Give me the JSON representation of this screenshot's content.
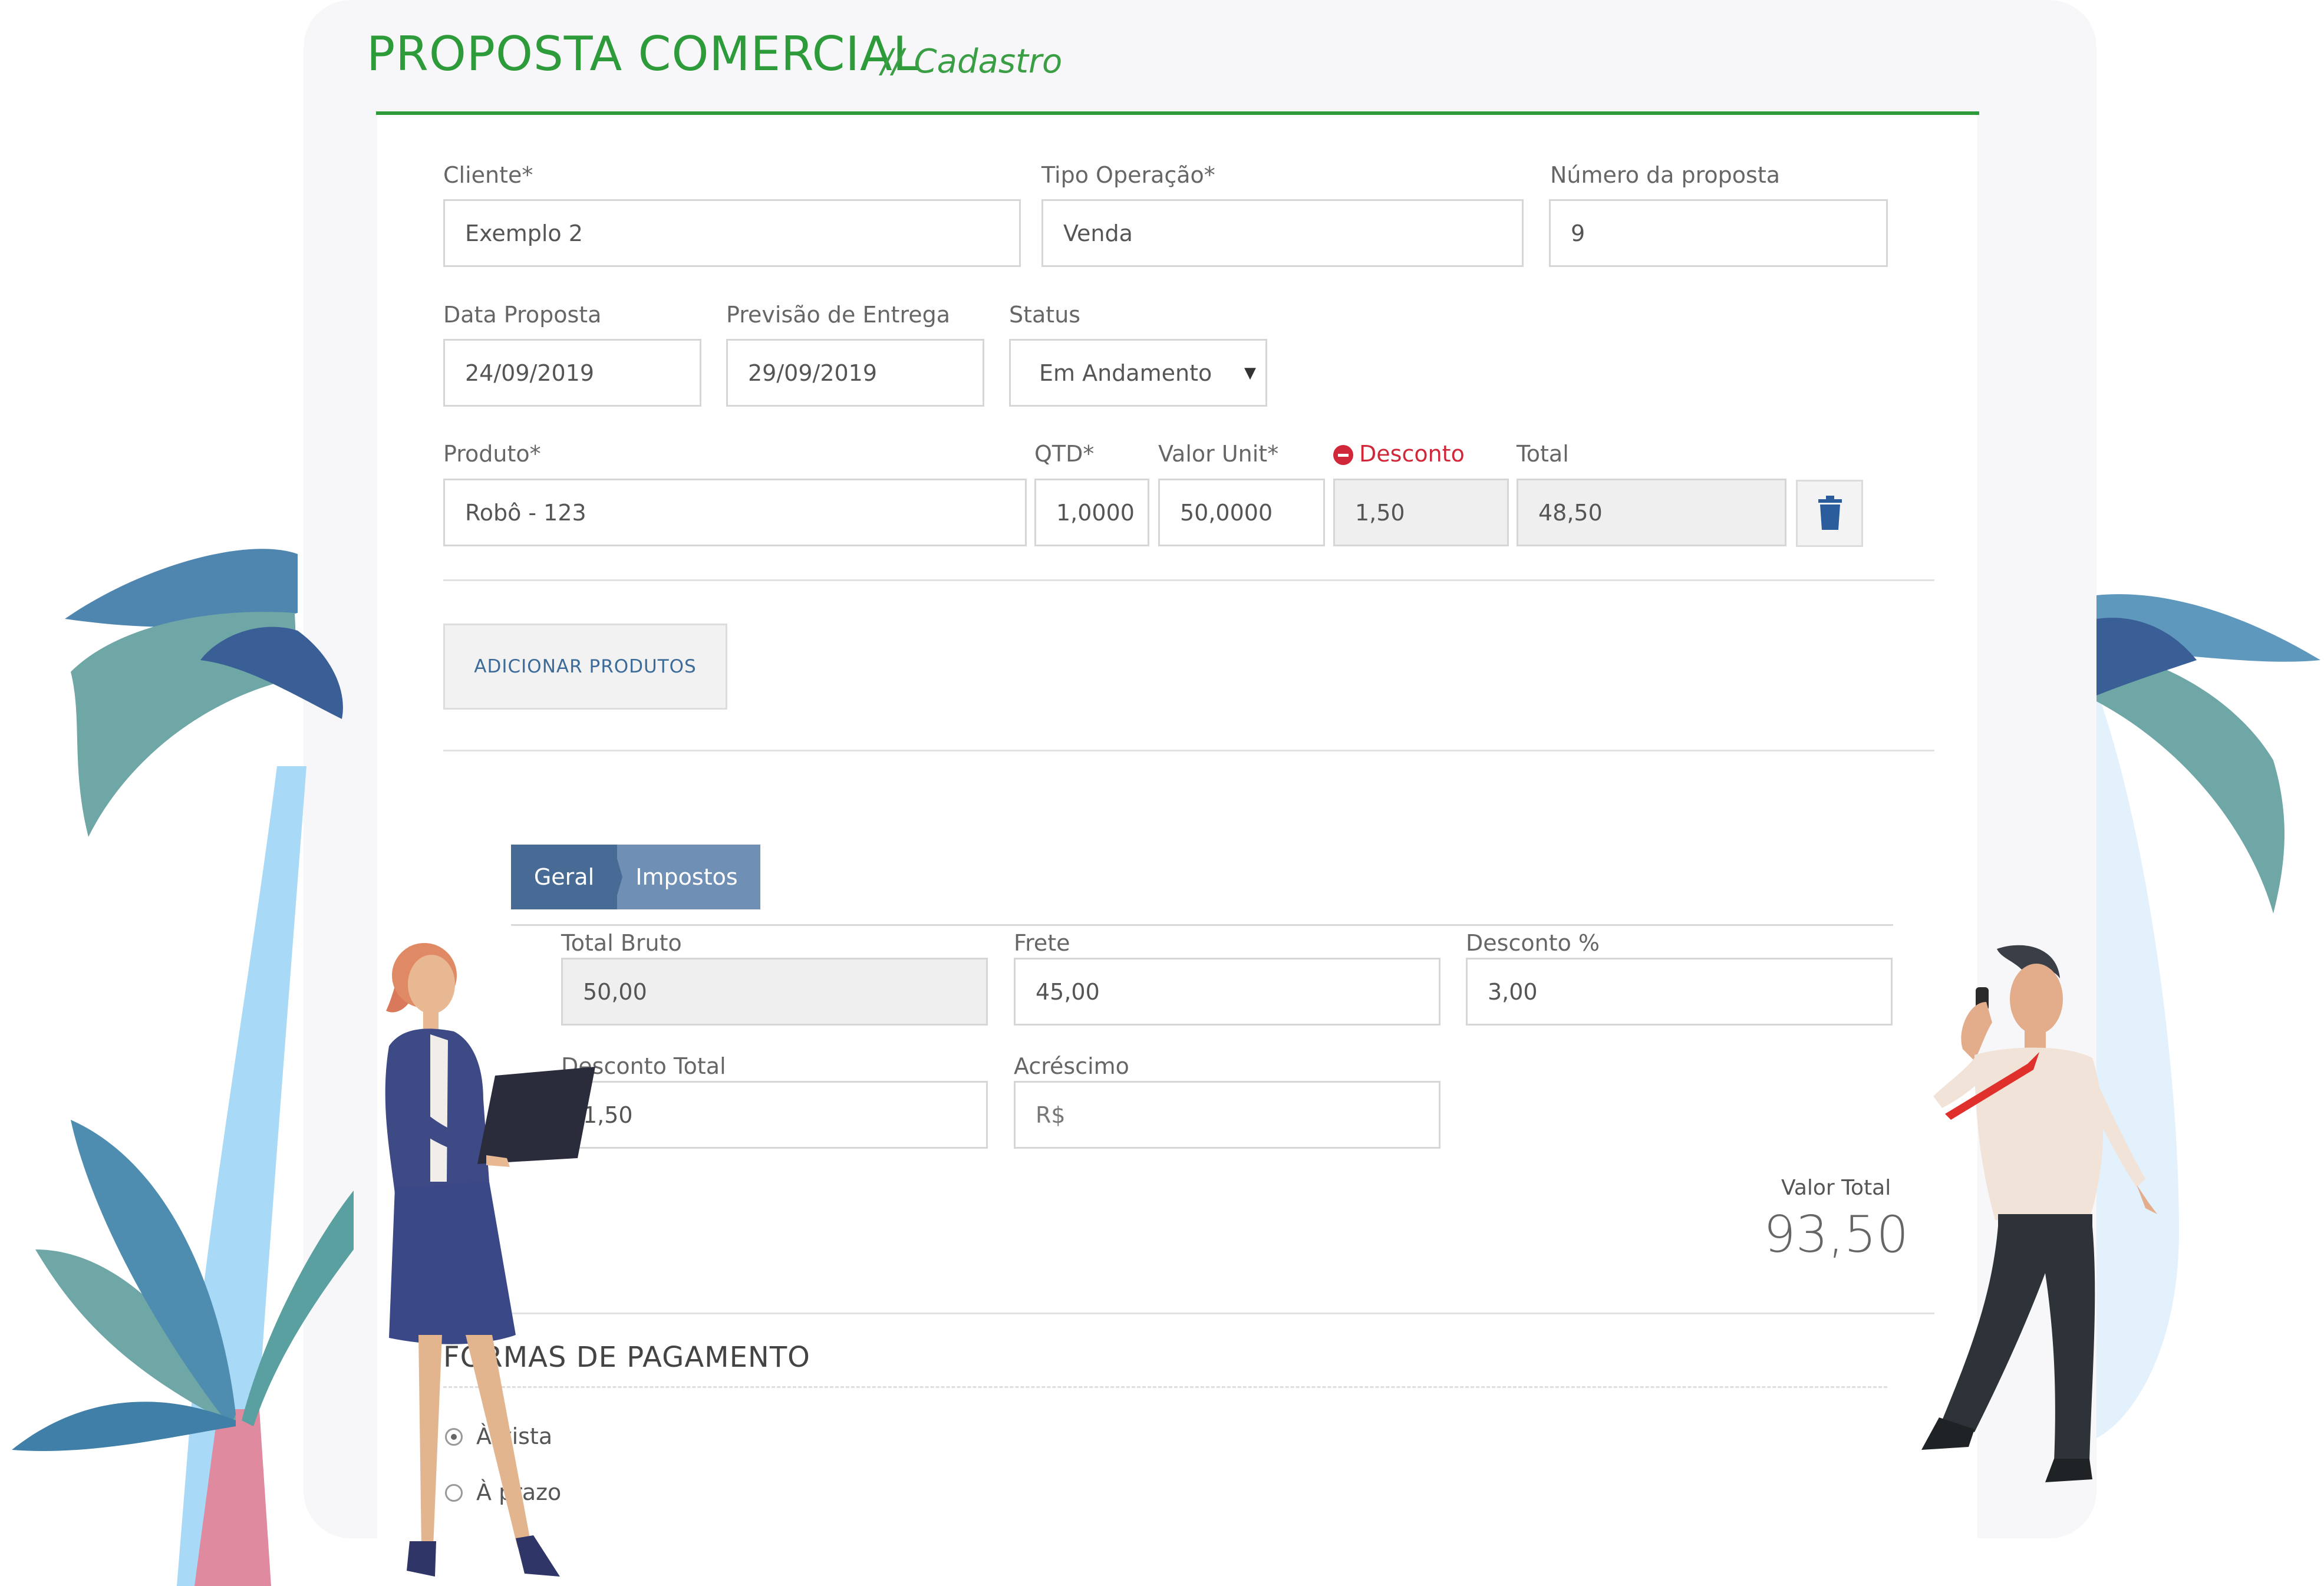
{
  "header": {
    "title": "PROPOSTA COMERCIAL",
    "subtitle": "// Cadastro"
  },
  "form": {
    "cliente": {
      "label": "Cliente*",
      "value": "Exemplo 2"
    },
    "tipo_operacao": {
      "label": "Tipo Operação*",
      "value": "Venda"
    },
    "numero_proposta": {
      "label": "Número da proposta",
      "value": "9"
    },
    "data_proposta": {
      "label": "Data Proposta",
      "value": "24/09/2019"
    },
    "previsao_entrega": {
      "label": "Previsão de Entrega",
      "value": "29/09/2019"
    },
    "status": {
      "label": "Status",
      "value": "Em Andamento"
    }
  },
  "product": {
    "labels": {
      "produto": "Produto*",
      "qtd": "QTD*",
      "valor_unit": "Valor Unit*",
      "desconto": "Desconto",
      "total": "Total"
    },
    "row": {
      "produto": "Robô - 123",
      "qtd": "1,0000",
      "valor_unit": "50,0000",
      "desconto": "1,50",
      "total": "48,50"
    },
    "add_button": "ADICIONAR PRODUTOS"
  },
  "tabs": [
    {
      "label": "Geral",
      "active": true
    },
    {
      "label": "Impostos",
      "active": false
    }
  ],
  "totals": {
    "total_bruto": {
      "label": "Total Bruto",
      "value": "50,00"
    },
    "frete": {
      "label": "Frete",
      "value": "45,00"
    },
    "desconto_pct": {
      "label": "Desconto %",
      "value": "3,00"
    },
    "desconto_total": {
      "label": "Desconto Total",
      "value": "1,50"
    },
    "acrescimo": {
      "label": "Acréscimo",
      "placeholder": "R$"
    },
    "valor_total": {
      "label": "Valor Total",
      "value": "93,50"
    }
  },
  "payment": {
    "title": "FORMAS DE PAGAMENTO",
    "options": [
      {
        "label": "À vista",
        "checked": true
      },
      {
        "label": "À prazo",
        "checked": false
      }
    ]
  },
  "colors": {
    "brand_green": "#2e9b3a",
    "tab_active": "#476b95",
    "tab_inactive": "#6f8fb4",
    "danger": "#d0283a",
    "button_text": "#3c6a99"
  },
  "icons": {
    "trash": "trash-icon",
    "minus_circle": "minus-circle-icon",
    "dropdown": "caret-down-icon"
  }
}
